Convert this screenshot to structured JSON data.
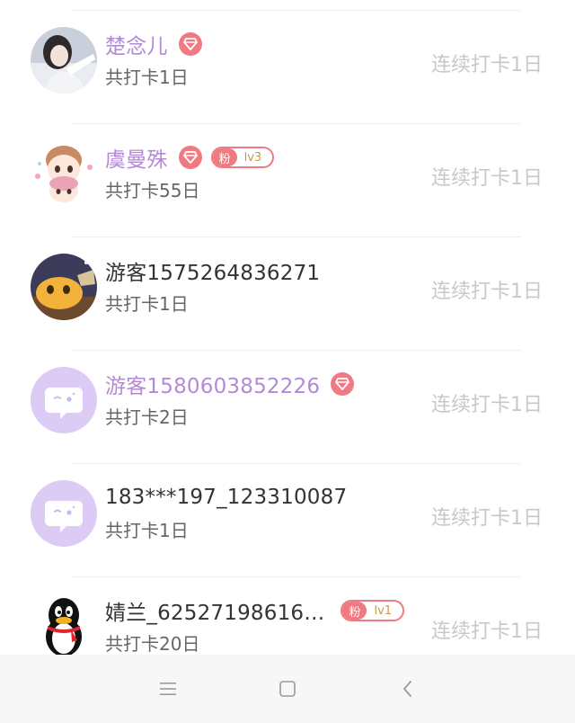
{
  "streak_prefix": "连续打卡",
  "rows": [
    {
      "name": "楚念儿",
      "days": "共打卡1日",
      "streak": "连续打卡1日",
      "vip": true,
      "avatar": "girl-photo-avatar"
    },
    {
      "name": "虞曼殊",
      "days": "共打卡55日",
      "streak": "连续打卡1日",
      "vip": true,
      "fan_label": "粉",
      "fan_level": "lv3",
      "avatar": "cartoon-girls-avatar"
    },
    {
      "name": "游客1575264836271",
      "days": "共打卡1日",
      "streak": "连续打卡1日",
      "vip": false,
      "avatar": "cartoon-pet-avatar"
    },
    {
      "name": "游客1580603852226",
      "days": "共打卡2日",
      "streak": "连续打卡1日",
      "vip": true,
      "avatar": "chat-bubble-avatar"
    },
    {
      "name": "183***197_123310087",
      "days": "共打卡1日",
      "streak": "连续打卡1日",
      "vip": false,
      "avatar": "chat-bubble-avatar"
    },
    {
      "name": "婧兰_62527198616…",
      "days": "共打卡20日",
      "streak": "连续打卡1日",
      "vip": false,
      "fan_label": "粉",
      "fan_level": "lv1",
      "avatar": "qq-penguin-avatar"
    }
  ],
  "colors": {
    "vip_name": "#b48ad6",
    "badge": "#f07a82",
    "streak": "#c8c8c8",
    "placeholder_avatar": "#dccbf5"
  },
  "navbar": {
    "icons": [
      "menu-icon",
      "home-square-icon",
      "back-icon"
    ]
  }
}
